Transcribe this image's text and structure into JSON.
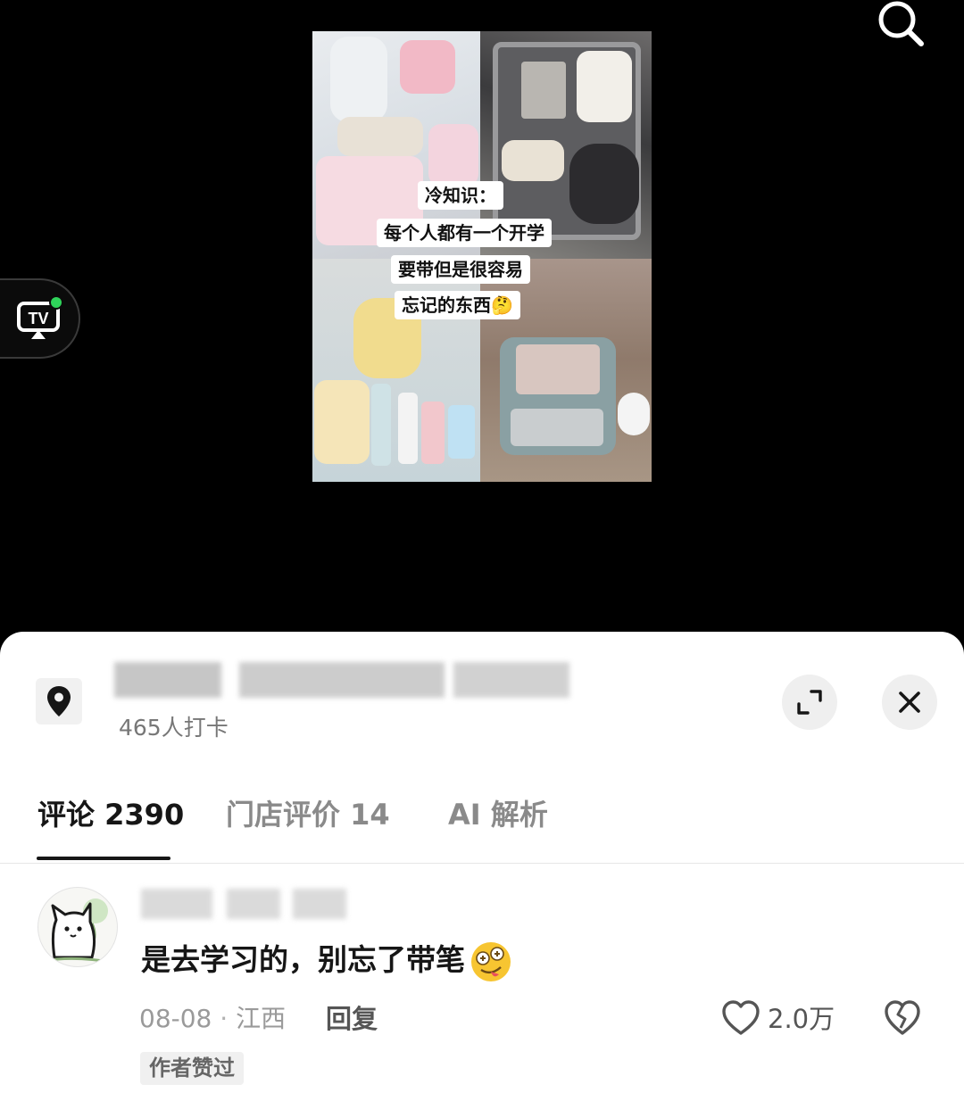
{
  "video": {
    "captions": [
      "冷知识：",
      "每个人都有一个开学",
      "要带但是很容易",
      "忘记的东西🤔"
    ],
    "tv_label": "TV"
  },
  "icons": {
    "search": "search-icon",
    "tv": "tv-cast-icon",
    "location": "location-pin-icon",
    "expand": "expand-icon",
    "close": "close-icon",
    "like": "heart-icon",
    "dislike": "broken-heart-icon"
  },
  "location": {
    "checkin": "465人打卡"
  },
  "tabs": [
    {
      "label": "评论 2390",
      "active": true
    },
    {
      "label": "门店评价 14",
      "active": false
    },
    {
      "label": "AI 解析",
      "active": false
    }
  ],
  "comment": {
    "text": "是去学习的，别忘了带笔",
    "date": "08-08",
    "separator": " · ",
    "region": "江西",
    "reply_label": "回复",
    "like_count": "2.0万",
    "author_liked_badge": "作者赞过"
  },
  "colors": {
    "active_tab": "#161616",
    "inactive_tab": "#8a8a8a",
    "sheet_bg": "#ffffff",
    "video_bg": "#000000",
    "tv_status_dot": "#2fd35a"
  }
}
